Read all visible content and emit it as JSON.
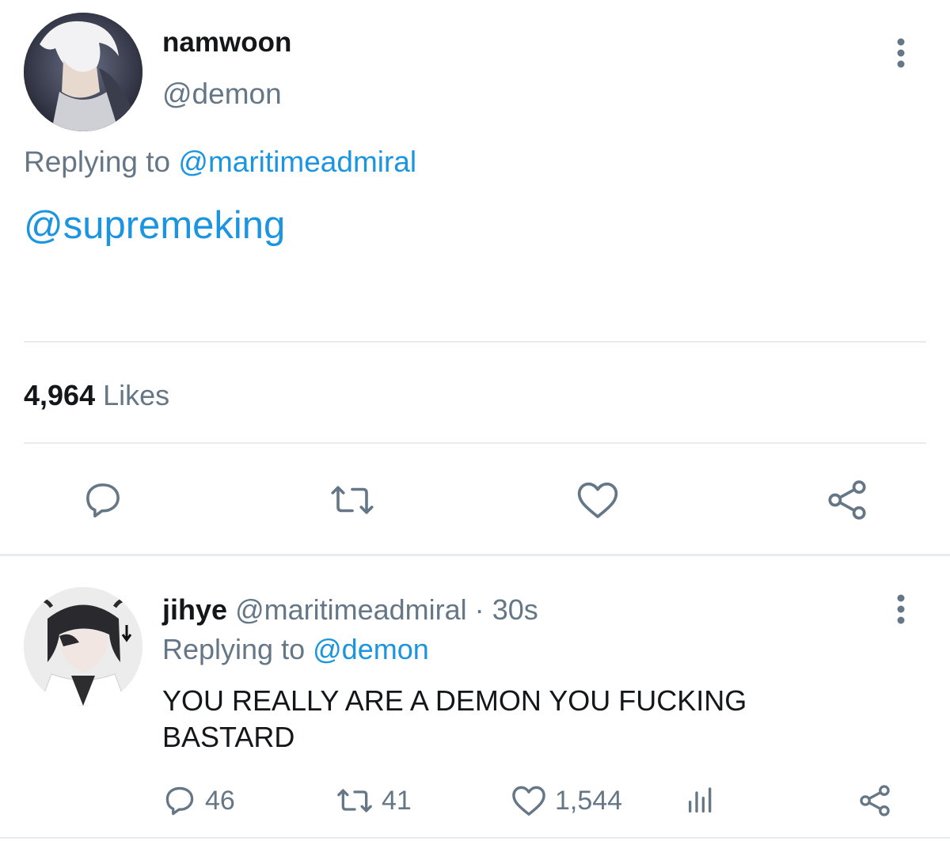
{
  "main_tweet": {
    "author_name": "namwoon",
    "author_handle": "@demon",
    "replying_label": "Replying to",
    "replying_handle": "@maritimeadmiral",
    "body_mention": "@supremeking",
    "likes_count": "4,964",
    "likes_label": "Likes",
    "icons": {
      "more": "more-vertical-icon",
      "reply": "reply-icon",
      "retweet": "retweet-icon",
      "like": "heart-icon",
      "share": "share-icon"
    }
  },
  "reply_tweet": {
    "author_name": "jihye",
    "author_handle": "@maritimeadmiral",
    "separator": "·",
    "time": "30s",
    "replying_label": "Replying to",
    "replying_handle": "@demon",
    "text": "YOU REALLY ARE A DEMON YOU FUCKING BASTARD",
    "reply_count": "46",
    "retweet_count": "41",
    "like_count": "1,544",
    "icons": {
      "more": "more-vertical-icon",
      "reply": "reply-icon",
      "retweet": "retweet-icon",
      "like": "heart-icon",
      "analytics": "analytics-icon",
      "share": "share-icon"
    }
  },
  "colors": {
    "link": "#1b95e0",
    "muted": "#657786",
    "text": "#14171a",
    "divider": "#e9ecef"
  }
}
